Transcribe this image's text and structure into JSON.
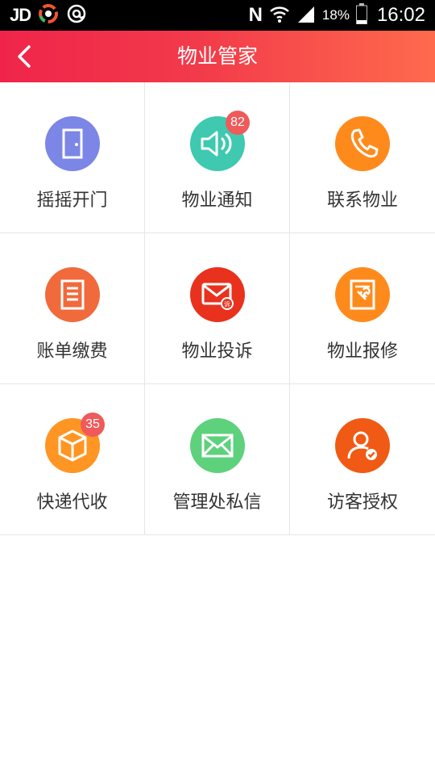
{
  "status_bar": {
    "carrier_logo": "JD",
    "percent": "18%",
    "time": "16:02",
    "icons": [
      "app-icon",
      "at-icon",
      "nfc-icon",
      "wifi-icon",
      "signal-icon",
      "battery-icon"
    ]
  },
  "header": {
    "title": "物业管家",
    "back_icon": "chevron-left-icon"
  },
  "grid": [
    {
      "label": "摇摇开门",
      "icon": "door-icon",
      "color": "#7b86e6",
      "badge": ""
    },
    {
      "label": "物业通知",
      "icon": "speaker-icon",
      "color": "#3ec9b0",
      "badge": "82"
    },
    {
      "label": "联系物业",
      "icon": "phone-icon",
      "color": "#ff8a1c",
      "badge": ""
    },
    {
      "label": "账单缴费",
      "icon": "bill-icon",
      "color": "#f06a3c",
      "badge": ""
    },
    {
      "label": "物业投诉",
      "icon": "complaint-mail-icon",
      "color": "#e8321e",
      "badge": ""
    },
    {
      "label": "物业报修",
      "icon": "repair-icon",
      "color": "#ff8a1c",
      "badge": ""
    },
    {
      "label": "快递代收",
      "icon": "package-icon",
      "color": "#ff9522",
      "badge": "35"
    },
    {
      "label": "管理处私信",
      "icon": "mail-icon",
      "color": "#5ed17c",
      "badge": ""
    },
    {
      "label": "访客授权",
      "icon": "visitor-icon",
      "color": "#f05a14",
      "badge": ""
    }
  ]
}
